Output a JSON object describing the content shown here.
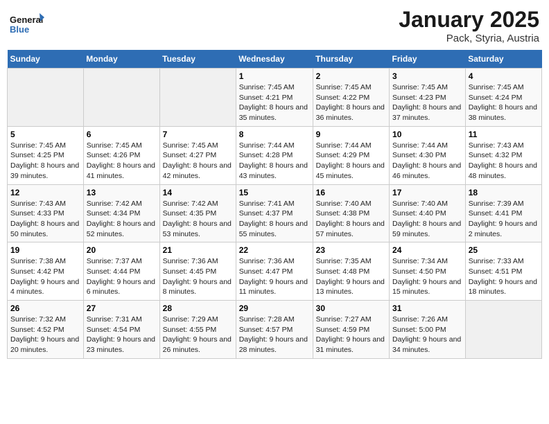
{
  "logo": {
    "text_general": "General",
    "text_blue": "Blue"
  },
  "title": "January 2025",
  "subtitle": "Pack, Styria, Austria",
  "days_header": [
    "Sunday",
    "Monday",
    "Tuesday",
    "Wednesday",
    "Thursday",
    "Friday",
    "Saturday"
  ],
  "weeks": [
    [
      {
        "num": "",
        "detail": ""
      },
      {
        "num": "",
        "detail": ""
      },
      {
        "num": "",
        "detail": ""
      },
      {
        "num": "1",
        "detail": "Sunrise: 7:45 AM\nSunset: 4:21 PM\nDaylight: 8 hours and 35 minutes."
      },
      {
        "num": "2",
        "detail": "Sunrise: 7:45 AM\nSunset: 4:22 PM\nDaylight: 8 hours and 36 minutes."
      },
      {
        "num": "3",
        "detail": "Sunrise: 7:45 AM\nSunset: 4:23 PM\nDaylight: 8 hours and 37 minutes."
      },
      {
        "num": "4",
        "detail": "Sunrise: 7:45 AM\nSunset: 4:24 PM\nDaylight: 8 hours and 38 minutes."
      }
    ],
    [
      {
        "num": "5",
        "detail": "Sunrise: 7:45 AM\nSunset: 4:25 PM\nDaylight: 8 hours and 39 minutes."
      },
      {
        "num": "6",
        "detail": "Sunrise: 7:45 AM\nSunset: 4:26 PM\nDaylight: 8 hours and 41 minutes."
      },
      {
        "num": "7",
        "detail": "Sunrise: 7:45 AM\nSunset: 4:27 PM\nDaylight: 8 hours and 42 minutes."
      },
      {
        "num": "8",
        "detail": "Sunrise: 7:44 AM\nSunset: 4:28 PM\nDaylight: 8 hours and 43 minutes."
      },
      {
        "num": "9",
        "detail": "Sunrise: 7:44 AM\nSunset: 4:29 PM\nDaylight: 8 hours and 45 minutes."
      },
      {
        "num": "10",
        "detail": "Sunrise: 7:44 AM\nSunset: 4:30 PM\nDaylight: 8 hours and 46 minutes."
      },
      {
        "num": "11",
        "detail": "Sunrise: 7:43 AM\nSunset: 4:32 PM\nDaylight: 8 hours and 48 minutes."
      }
    ],
    [
      {
        "num": "12",
        "detail": "Sunrise: 7:43 AM\nSunset: 4:33 PM\nDaylight: 8 hours and 50 minutes."
      },
      {
        "num": "13",
        "detail": "Sunrise: 7:42 AM\nSunset: 4:34 PM\nDaylight: 8 hours and 52 minutes."
      },
      {
        "num": "14",
        "detail": "Sunrise: 7:42 AM\nSunset: 4:35 PM\nDaylight: 8 hours and 53 minutes."
      },
      {
        "num": "15",
        "detail": "Sunrise: 7:41 AM\nSunset: 4:37 PM\nDaylight: 8 hours and 55 minutes."
      },
      {
        "num": "16",
        "detail": "Sunrise: 7:40 AM\nSunset: 4:38 PM\nDaylight: 8 hours and 57 minutes."
      },
      {
        "num": "17",
        "detail": "Sunrise: 7:40 AM\nSunset: 4:40 PM\nDaylight: 8 hours and 59 minutes."
      },
      {
        "num": "18",
        "detail": "Sunrise: 7:39 AM\nSunset: 4:41 PM\nDaylight: 9 hours and 2 minutes."
      }
    ],
    [
      {
        "num": "19",
        "detail": "Sunrise: 7:38 AM\nSunset: 4:42 PM\nDaylight: 9 hours and 4 minutes."
      },
      {
        "num": "20",
        "detail": "Sunrise: 7:37 AM\nSunset: 4:44 PM\nDaylight: 9 hours and 6 minutes."
      },
      {
        "num": "21",
        "detail": "Sunrise: 7:36 AM\nSunset: 4:45 PM\nDaylight: 9 hours and 8 minutes."
      },
      {
        "num": "22",
        "detail": "Sunrise: 7:36 AM\nSunset: 4:47 PM\nDaylight: 9 hours and 11 minutes."
      },
      {
        "num": "23",
        "detail": "Sunrise: 7:35 AM\nSunset: 4:48 PM\nDaylight: 9 hours and 13 minutes."
      },
      {
        "num": "24",
        "detail": "Sunrise: 7:34 AM\nSunset: 4:50 PM\nDaylight: 9 hours and 15 minutes."
      },
      {
        "num": "25",
        "detail": "Sunrise: 7:33 AM\nSunset: 4:51 PM\nDaylight: 9 hours and 18 minutes."
      }
    ],
    [
      {
        "num": "26",
        "detail": "Sunrise: 7:32 AM\nSunset: 4:52 PM\nDaylight: 9 hours and 20 minutes."
      },
      {
        "num": "27",
        "detail": "Sunrise: 7:31 AM\nSunset: 4:54 PM\nDaylight: 9 hours and 23 minutes."
      },
      {
        "num": "28",
        "detail": "Sunrise: 7:29 AM\nSunset: 4:55 PM\nDaylight: 9 hours and 26 minutes."
      },
      {
        "num": "29",
        "detail": "Sunrise: 7:28 AM\nSunset: 4:57 PM\nDaylight: 9 hours and 28 minutes."
      },
      {
        "num": "30",
        "detail": "Sunrise: 7:27 AM\nSunset: 4:59 PM\nDaylight: 9 hours and 31 minutes."
      },
      {
        "num": "31",
        "detail": "Sunrise: 7:26 AM\nSunset: 5:00 PM\nDaylight: 9 hours and 34 minutes."
      },
      {
        "num": "",
        "detail": ""
      }
    ]
  ]
}
